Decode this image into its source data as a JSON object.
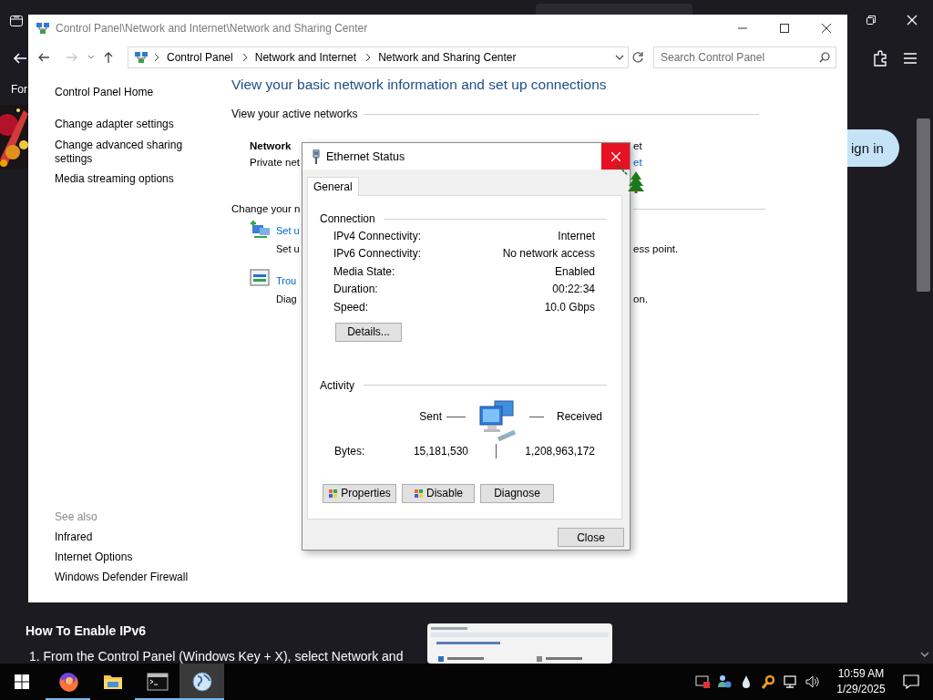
{
  "browser": {
    "menu_label": "For",
    "sign_in": "ign in",
    "article": {
      "heading": "How To Enable IPv6",
      "step": "1. From the Control Panel (Windows Key + X), select Network and"
    }
  },
  "control_panel": {
    "title": "Control Panel\\Network and Internet\\Network and Sharing Center",
    "breadcrumb": [
      "Control Panel",
      "Network and Internet",
      "Network and Sharing Center"
    ],
    "search": {
      "placeholder": "Search Control Panel"
    },
    "sidebar": {
      "links": [
        "Control Panel Home",
        "Change adapter settings",
        "Change advanced sharing settings",
        "Media streaming options"
      ],
      "see_also": {
        "heading": "See also",
        "links": [
          "Infrared",
          "Internet Options",
          "Windows Defender Firewall"
        ]
      }
    },
    "heading": "View your basic network information and set up connections",
    "active_networks_label": "View your active networks",
    "network": {
      "name": "Network",
      "type": "Private net",
      "access": "et",
      "connection": "et"
    },
    "change_label": "Change your n",
    "tasks": [
      {
        "kind": "setup",
        "link": "Set u",
        "description": "Set u",
        "tail": "ess point."
      },
      {
        "kind": "troubleshoot",
        "link": "Trou",
        "description": "Diag",
        "tail": "on."
      }
    ]
  },
  "dialog": {
    "title": "Ethernet Status",
    "tabs": [
      {
        "label": "General",
        "selected": true
      }
    ],
    "connection": {
      "heading": "Connection",
      "rows": [
        {
          "label": "IPv4 Connectivity:",
          "value": "Internet"
        },
        {
          "label": "IPv6 Connectivity:",
          "value": "No network access"
        },
        {
          "label": "Media State:",
          "value": "Enabled"
        },
        {
          "label": "Duration:",
          "value": "00:22:34"
        },
        {
          "label": "Speed:",
          "value": "10.0 Gbps"
        }
      ]
    },
    "details_button": "Details...",
    "activity": {
      "heading": "Activity",
      "sent_label": "Sent",
      "received_label": "Received",
      "bytes_label": "Bytes:",
      "sent": "15,181,530",
      "received": "1,208,963,172"
    },
    "buttons": [
      {
        "label": "Properties",
        "shield": true
      },
      {
        "label": "Disable",
        "shield": true
      },
      {
        "label": "Diagnose",
        "shield": false
      }
    ],
    "close_button": "Close"
  },
  "taskbar": {
    "apps": [
      {
        "kind": "browser",
        "selected": false,
        "running": true
      },
      {
        "kind": "folder",
        "selected": false,
        "running": false
      },
      {
        "kind": "terminal",
        "selected": false,
        "running": true
      },
      {
        "kind": "globe",
        "selected": true,
        "running": true
      }
    ],
    "time": "10:59 AM",
    "date": "1/29/2025"
  }
}
